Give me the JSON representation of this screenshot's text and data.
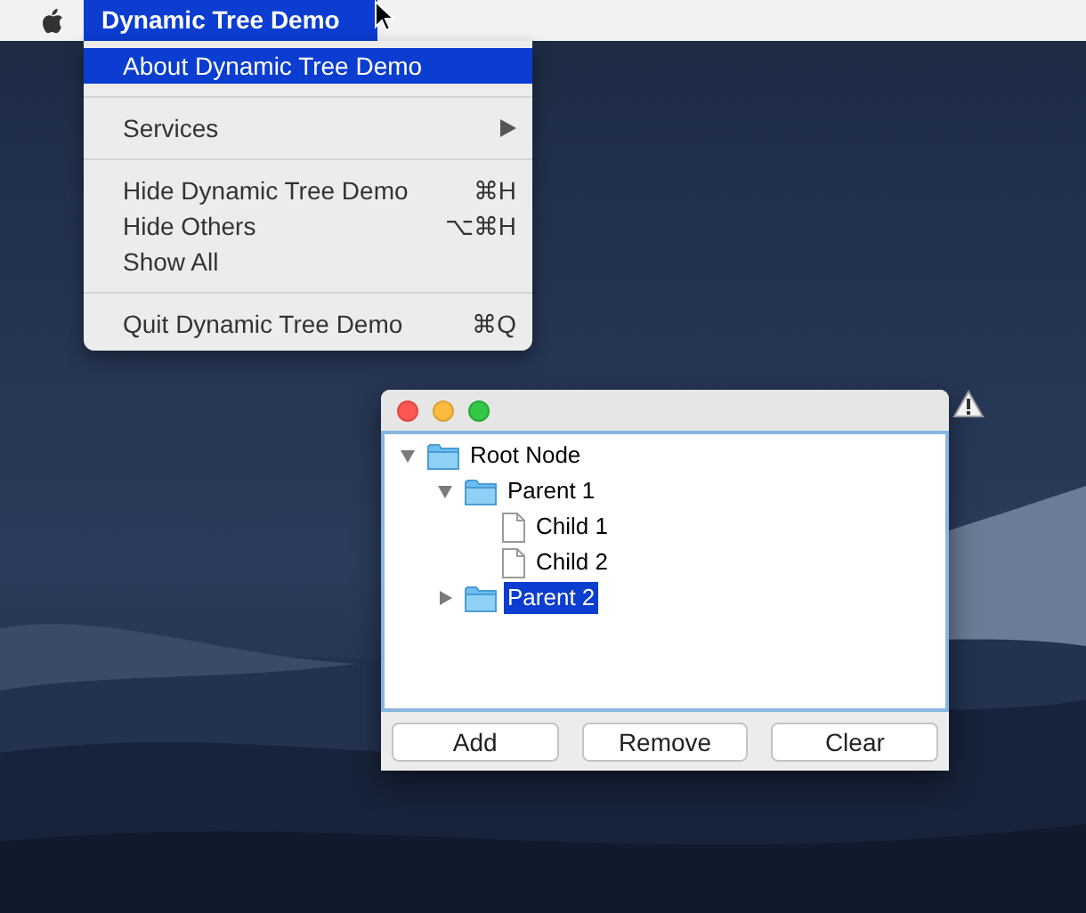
{
  "menu_bar": {
    "app_menu": {
      "label": "Dynamic Tree Demo",
      "selected": true
    }
  },
  "app_menu": {
    "items": [
      {
        "kind": "item",
        "label": "About Dynamic Tree Demo",
        "selected": true
      },
      {
        "kind": "separator"
      },
      {
        "kind": "submenu",
        "label": "Services",
        "selected": false
      },
      {
        "kind": "separator"
      },
      {
        "kind": "item",
        "label": "Hide Dynamic Tree Demo",
        "shortcut": "⌘H",
        "selected": false
      },
      {
        "kind": "item",
        "label": "Hide Others",
        "shortcut": "⌥⌘H",
        "selected": false
      },
      {
        "kind": "item",
        "label": "Show All",
        "selected": false
      },
      {
        "kind": "separator"
      },
      {
        "kind": "item",
        "label": "Quit Dynamic Tree Demo",
        "shortcut": "⌘Q",
        "selected": false
      }
    ]
  },
  "window": {
    "tree": [
      {
        "label": "Root Node",
        "kind": "folder",
        "expanded": true,
        "selected": false,
        "children": [
          {
            "label": "Parent 1",
            "kind": "folder",
            "expanded": true,
            "selected": false,
            "children": [
              {
                "label": "Child 1",
                "kind": "file",
                "selected": false
              },
              {
                "label": "Child 2",
                "kind": "file",
                "selected": false
              }
            ]
          },
          {
            "label": "Parent 2",
            "kind": "folder",
            "expanded": false,
            "selected": true
          }
        ]
      }
    ],
    "buttons": [
      "Add",
      "Remove",
      "Clear"
    ]
  }
}
